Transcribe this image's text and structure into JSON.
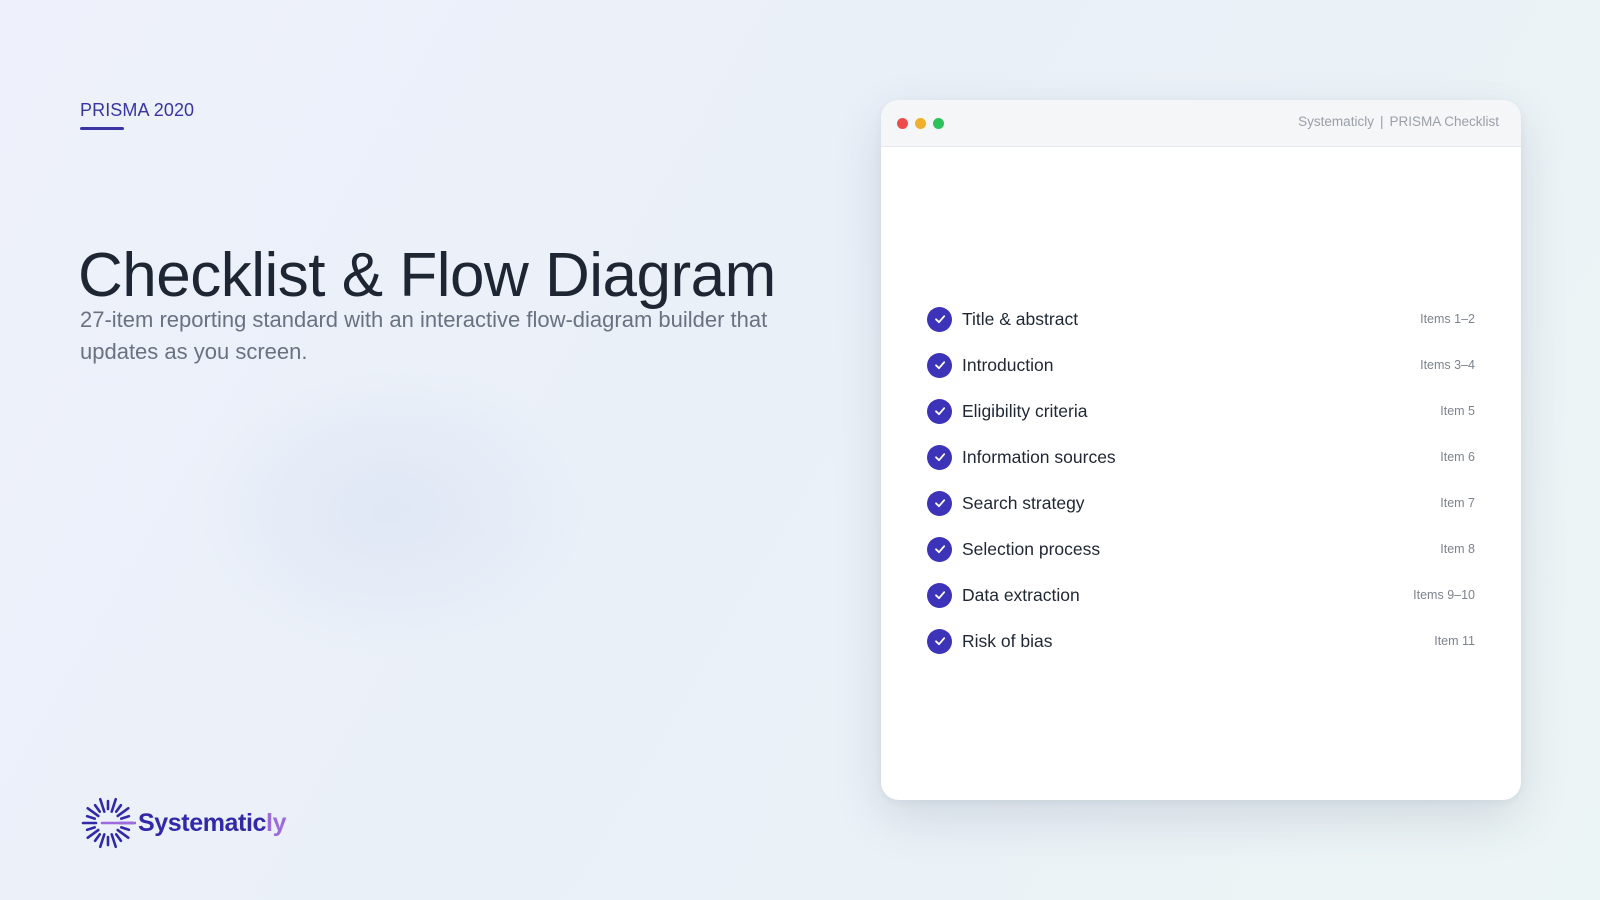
{
  "eyebrow": "PRISMA 2020",
  "title": "Checklist & Flow Diagram",
  "subtitle": "27-item reporting standard with an interactive flow-diagram builder that updates as you screen.",
  "brand": {
    "name_main": "Systematic",
    "name_accent": "ly",
    "icon": "sunburst-logo-icon",
    "colors": {
      "primary": "#3328a8",
      "accent": "#9d6bdb"
    }
  },
  "window": {
    "title_left": "Systematicly",
    "title_separator": "|",
    "title_right": "PRISMA Checklist",
    "controls": [
      "close-dot",
      "minimize-dot",
      "zoom-dot"
    ]
  },
  "checklist": {
    "check_color": "#3d33b8",
    "items": [
      {
        "label": "Title & abstract",
        "ref": "Items 1–2",
        "checked": true
      },
      {
        "label": "Introduction",
        "ref": "Items 3–4",
        "checked": true
      },
      {
        "label": "Eligibility criteria",
        "ref": "Item 5",
        "checked": true
      },
      {
        "label": "Information sources",
        "ref": "Item 6",
        "checked": true
      },
      {
        "label": "Search strategy",
        "ref": "Item 7",
        "checked": true
      },
      {
        "label": "Selection process",
        "ref": "Item 8",
        "checked": true
      },
      {
        "label": "Data extraction",
        "ref": "Items 9–10",
        "checked": true
      },
      {
        "label": "Risk of bias",
        "ref": "Item 11",
        "checked": true
      }
    ]
  }
}
